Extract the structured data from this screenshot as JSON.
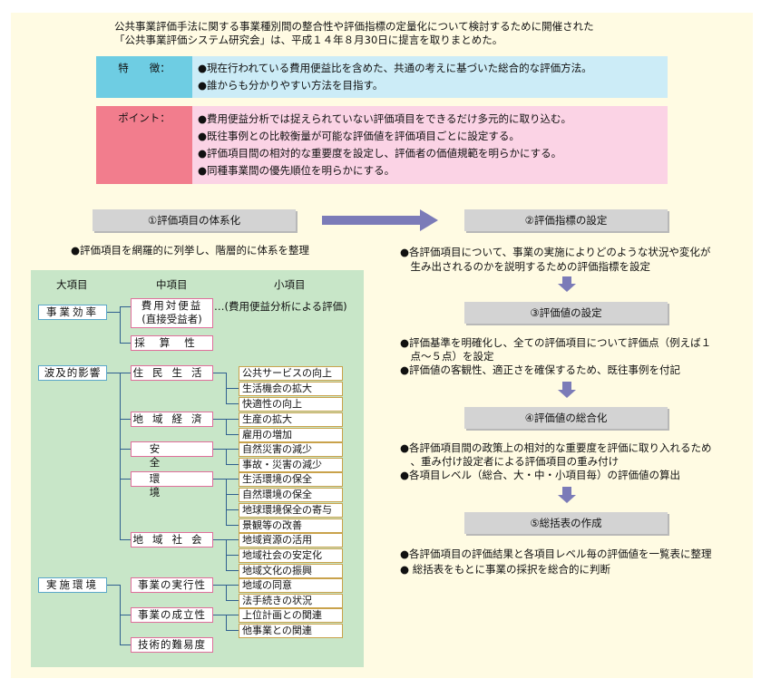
{
  "intro": {
    "line1": "公共事業評価手法に関する事業種別間の整合性や評価指標の定量化について検討するために開催された",
    "line2": "「公共事業評価システム研究会」は、平成１４年８月30日に提言を取りまとめた。"
  },
  "features": {
    "label": "特　　徴：",
    "items": [
      "●現在行われている費用便益比を含めた、共通の考えに基づいた総合的な評価方法。",
      "●誰からも分かりやすい方法を目指す。"
    ]
  },
  "points": {
    "label": "ポイント：",
    "items": [
      "●費用便益分析では捉えられていない評価項目をできるだけ多元的に取り込む。",
      "●既往事例との比較衡量が可能な評価値を評価項目ごとに設定する。",
      "●評価項目間の相対的な重要度を設定し、評価者の価値規範を明らかにする。",
      "●同種事業間の優先順位を明らかにする。"
    ]
  },
  "left_step": {
    "title": "①評価項目の体系化",
    "note": "●評価項目を網羅的に列挙し、階層的に体系を整理"
  },
  "hierarchy": {
    "headers": [
      "大項目",
      "中項目",
      "小項目"
    ],
    "majors": [
      "事業効率",
      "波及的影響",
      "実施環境"
    ],
    "mids": {
      "cost_benefit_line1": "費用対便益",
      "cost_benefit_line2": "(直接受益者)",
      "cost_benefit_note": "…(費用便益分析による評価)",
      "profit": "採算性",
      "residents": "住民生活",
      "economy": "地域経済",
      "safety": "安全",
      "environment": "環境",
      "society": "地域社会",
      "feasibility": "事業の実行性",
      "viability": "事業の成立性",
      "technical": "技術的難易度"
    },
    "minors": [
      "公共サービスの向上",
      "生活機会の拡大",
      "快適性の向上",
      "生産の拡大",
      "雇用の増加",
      "自然災害の減少",
      "事故・災害の減少",
      "生活環境の保全",
      "自然環境の保全",
      "地球環境保全の寄与",
      "景観等の改善",
      "地域資源の活用",
      "地域社会の安定化",
      "地域文化の振興",
      "地域の同意",
      "法手続きの状況",
      "上位計画との関連",
      "他事業との関連"
    ]
  },
  "right_steps": [
    {
      "title": "②評価指標の設定",
      "notes": [
        "●各評価項目について、事業の実施によりどのような状況や変化が",
        "　生み出されるのかを説明するための評価指標を設定"
      ]
    },
    {
      "title": "③評価値の設定",
      "notes": [
        "●評価基準を明確化し、全ての評価項目について評価点（例えば１",
        "　点〜５点）を設定",
        "●評価値の客観性、適正さを確保するため、既往事例を付記"
      ]
    },
    {
      "title": "④評価値の総合化",
      "notes": [
        "●各評価項目間の政策上の相対的な重要度を評価に取り入れるため",
        "　、重み付け設定者による評価項目の重み付け",
        "●各項目レベル（総合、大・中・小項目毎）の評価値の算出"
      ]
    },
    {
      "title": "⑤総括表の作成",
      "notes": [
        "●各評価項目の評価結果と各項目レベル毎の評価値を一覧表に整理",
        "●  総括表をもとに事業の採択を総合的に判断"
      ]
    }
  ],
  "colors": {
    "background": "#fffbe3",
    "feature_label": "#6ecde3",
    "feature_body": "#ccecf7",
    "point_label": "#f27d8d",
    "point_body": "#fbd3e5",
    "hierarchy_panel": "#c8e6c8",
    "arrow": "#7b7bb8"
  }
}
